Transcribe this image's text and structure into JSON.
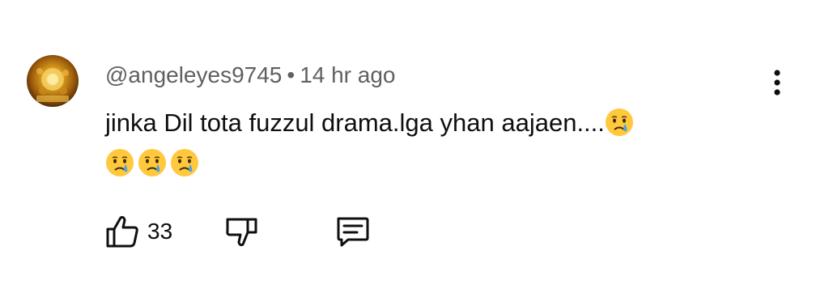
{
  "comment": {
    "author_handle": "@angeleyes9745",
    "separator": "•",
    "timestamp": "14 hr ago",
    "text": "jinka Dil tota fuzzul drama.lga yhan aajaen....",
    "emojis_inline": [
      "crying-face-emoji"
    ],
    "emojis_trailing": [
      "crying-face-emoji",
      "crying-face-emoji",
      "crying-face-emoji"
    ],
    "avatar_icon": "golden-ornament-avatar"
  },
  "actions": {
    "like_icon": "thumbs-up-icon",
    "like_count": "33",
    "dislike_icon": "thumbs-down-icon",
    "reply_icon": "comment-reply-icon",
    "more_icon": "vertical-ellipsis-icon"
  },
  "colors": {
    "text_primary": "#0f0f0f",
    "text_secondary": "#606060",
    "emoji_face": "#FFC83D",
    "emoji_tear": "#4FA3E0"
  }
}
